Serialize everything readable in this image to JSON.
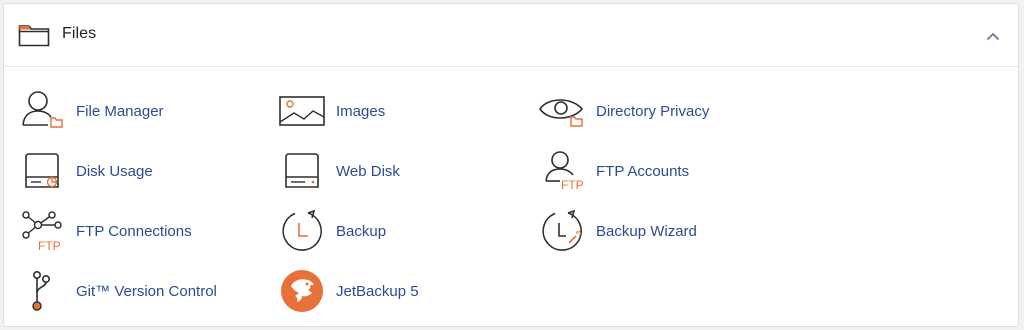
{
  "section": {
    "title": "Files",
    "icons": {
      "header": "folder-icon",
      "toggle": "chevron-up-icon"
    }
  },
  "items": [
    {
      "label": "File Manager",
      "icon": "file-manager-icon"
    },
    {
      "label": "Images",
      "icon": "images-icon"
    },
    {
      "label": "Directory Privacy",
      "icon": "directory-privacy-icon"
    },
    {
      "label": "Disk Usage",
      "icon": "disk-usage-icon"
    },
    {
      "label": "Web Disk",
      "icon": "web-disk-icon"
    },
    {
      "label": "FTP Accounts",
      "icon": "ftp-accounts-icon"
    },
    {
      "label": "FTP Connections",
      "icon": "ftp-connections-icon"
    },
    {
      "label": "Backup",
      "icon": "backup-icon"
    },
    {
      "label": "Backup Wizard",
      "icon": "backup-wizard-icon"
    },
    {
      "label": "Git™ Version Control",
      "icon": "git-version-control-icon"
    },
    {
      "label": "JetBackup 5",
      "icon": "jetbackup-icon"
    }
  ],
  "icon_text": {
    "ftp": "FTP"
  },
  "colors": {
    "accent": "#e8703a",
    "link": "#2c4b95",
    "line": "#2f2f2f"
  }
}
